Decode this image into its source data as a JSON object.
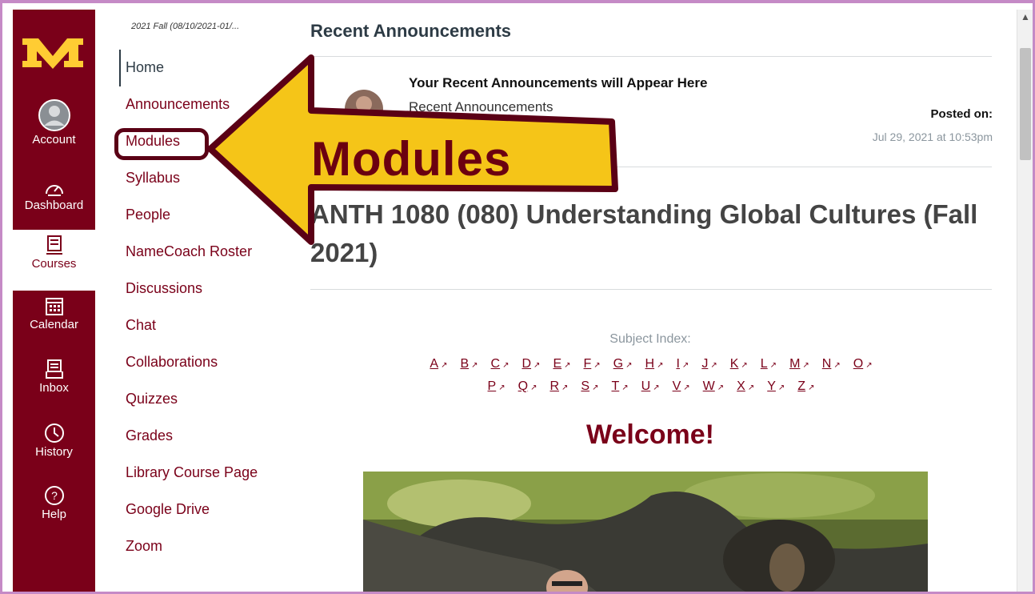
{
  "global_nav": {
    "items": [
      {
        "label": "Account",
        "icon": "account-icon"
      },
      {
        "label": "Dashboard",
        "icon": "dashboard-icon"
      },
      {
        "label": "Courses",
        "icon": "courses-icon",
        "active": true
      },
      {
        "label": "Calendar",
        "icon": "calendar-icon"
      },
      {
        "label": "Inbox",
        "icon": "inbox-icon"
      },
      {
        "label": "History",
        "icon": "history-icon"
      },
      {
        "label": "Help",
        "icon": "help-icon"
      }
    ]
  },
  "course_nav": {
    "term": "2021 Fall (08/10/2021-01/...",
    "items": [
      "Home",
      "Announcements",
      "Modules",
      "Syllabus",
      "People",
      "NameCoach Roster",
      "Discussions",
      "Chat",
      "Collaborations",
      "Quizzes",
      "Grades",
      "Library Course Page",
      "Google Drive",
      "Zoom"
    ]
  },
  "announcements": {
    "heading": "Recent Announcements",
    "title": "Your Recent Announcements will Appear Here",
    "subtitle": "Recent Announcements",
    "posted_label": "Posted on:",
    "posted_date": "Jul 29, 2021 at 10:53pm"
  },
  "course": {
    "title": "ANTH 1080 (080) Understanding Global Cultures (Fall 2021)"
  },
  "subject_index": {
    "label": "Subject Index:",
    "row1": [
      "A",
      "B",
      "C",
      "D",
      "E",
      "F",
      "G",
      "H",
      "I",
      "J",
      "K",
      "L",
      "M",
      "N",
      "O"
    ],
    "row2": [
      "P",
      "Q",
      "R",
      "S",
      "T",
      "U",
      "V",
      "W",
      "X",
      "Y",
      "Z"
    ]
  },
  "welcome": "Welcome!",
  "callout": {
    "text": "Modules"
  },
  "colors": {
    "maroon": "#7a0019",
    "gold": "#ffcc33",
    "callout_fill": "#f5c518"
  }
}
